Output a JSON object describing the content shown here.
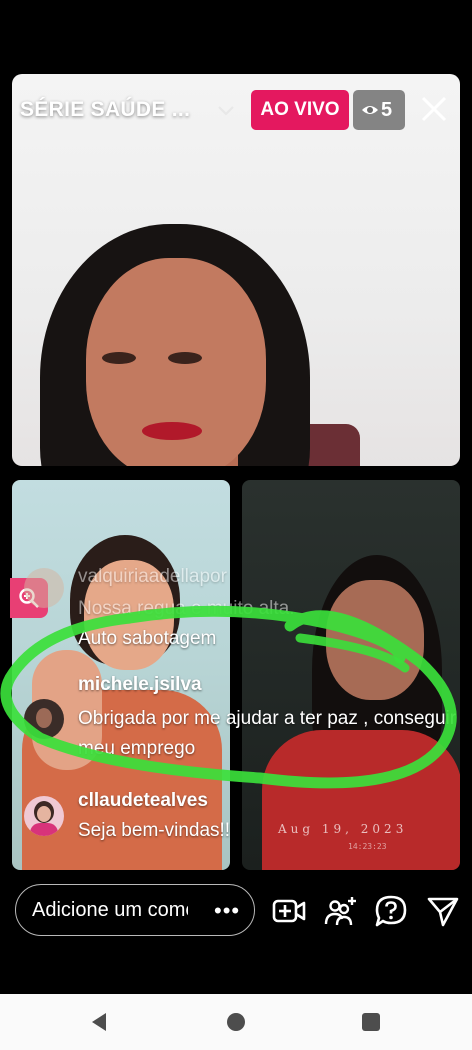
{
  "stream": {
    "title": "SÉRIE SAÚDE ...",
    "live_label": "AO VIVO",
    "viewer_count": "5"
  },
  "guest_right": {
    "timestamp": "Aug 19, 2023",
    "time": "14:23:23"
  },
  "comments": [
    {
      "user": "valquiriaadellapor",
      "text": "Nossa regua e muito alta.",
      "faded": true
    },
    {
      "user": "",
      "text": "Auto sabotagem",
      "faded": false
    },
    {
      "user": "michele.jsilva",
      "text": "Obrigada por me ajudar a ter paz , conseguir meu emprego",
      "faded": false
    },
    {
      "user": "cllaudetealves",
      "text": "Seja bem-vindas!!",
      "faded": false
    }
  ],
  "composer": {
    "placeholder": "Adicione um comentário",
    "more_label": "•••"
  },
  "icons": {
    "mic": "microphone-icon",
    "camera": "video-camera-icon",
    "flip": "flip-camera-icon",
    "effects": "sparkles-icon",
    "add_guest": "add-video-icon",
    "invite": "add-people-icon",
    "question": "question-icon",
    "share": "send-icon",
    "eye": "eye-icon",
    "close": "close-icon"
  },
  "colors": {
    "live_badge": "#e4185f",
    "side_button": "#e83f74",
    "highlight": "#3be03b"
  }
}
